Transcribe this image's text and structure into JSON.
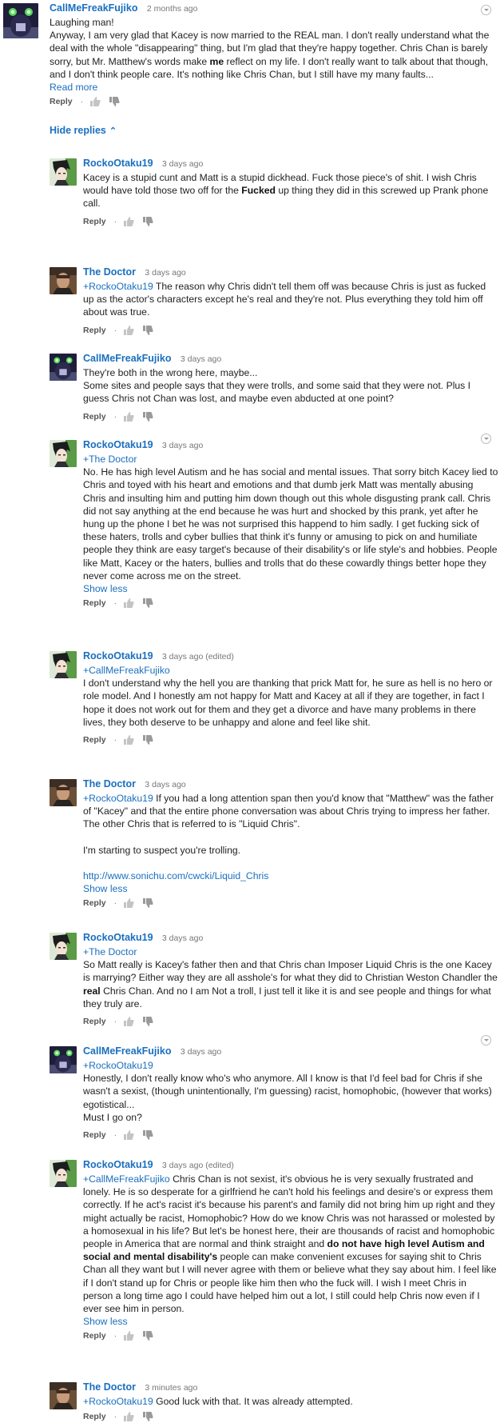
{
  "labels": {
    "reply": "Reply",
    "dot": "·",
    "read_more": "Read more",
    "show_less": "Show less",
    "hide_replies": "Hide replies"
  },
  "comments": [
    {
      "author": "CallMeFreakFujiko",
      "time": "2 months ago",
      "lines": [
        "Laughing man!",
        "Anyway, I am very glad that Kacey is now married to the REAL man. I don't really understand what the deal with the whole \"disappearing\" thing, but I'm glad that they're happy together. Chris Chan is barely sorry, but Mr. Matthew's words make ",
        "me",
        " reflect on my life. I don't really want to talk about that though, and I don't think people care. It's nothing like Chris Chan, but I still have my many faults..."
      ]
    },
    {
      "author": "RockoOtaku19",
      "time": "3 days ago",
      "t1": "Kacey is a stupid cunt and Matt is a stupid dickhead. Fuck those piece's of shit. I wish Chris would have told those two off for the ",
      "b1": "Fucked",
      "t2": " up thing they did in this screwed up Prank phone call."
    },
    {
      "author": "The Doctor",
      "time": "3 days ago",
      "mention": "+RockoOtaku19",
      "text": " The reason why Chris didn't tell them off was because Chris is just as fucked up as the actor's characters except he's real and they're not. Plus everything they told him off about was true."
    },
    {
      "author": "CallMeFreakFujiko",
      "time": "3 days ago",
      "lines": [
        "They're both in the wrong here, maybe...",
        "Some sites and people says that they were trolls, and some said that they were not. Plus I guess Chris not Chan was lost, and maybe even abducted at one point?"
      ]
    },
    {
      "author": "RockoOtaku19",
      "time": "3 days ago",
      "mention": "+The Doctor",
      "text": "No. He has high level Autism and he has social and mental issues. That sorry bitch Kacey lied to Chris and toyed with his heart and emotions and that dumb jerk Matt was mentally abusing Chris and insulting him and putting him down though out this whole disgusting prank call. Chris did not say anything at the end because he was hurt and shocked by this prank, yet after he hung up the phone I bet he was not surprised this happend to him sadly.  I get fucking sick of these haters, trolls and cyber bullies that think it's funny or amusing to pick on and humiliate people they think are easy target's because of their disability's or life style's and hobbies. People like Matt, Kacey or the haters, bullies and trolls that do these cowardly things better hope they never come across me on the street."
    },
    {
      "author": "RockoOtaku19",
      "time": "3 days ago (edited)",
      "mention": "+CallMeFreakFujiko",
      "text": "I don't understand why the hell you are thanking that prick Matt for, he sure as hell is no hero or role model.  And I honestly am not happy for Matt and Kacey at all if they are together, in fact I hope it does not work out for them and they get a divorce and have many problems in there lives, they both deserve to be unhappy and alone and feel like shit."
    },
    {
      "author": "The Doctor",
      "time": "3 days ago",
      "mention": "+RockoOtaku19",
      "text": " If you had a long attention span then you'd know that \"Matthew\" was the father of \"Kacey\" and that the entire phone conversation was about Chris trying to impress her father. The other Chris that is referred to is \"Liquid Chris\".",
      "text2": "I'm starting to suspect you're trolling.",
      "link": "http://www.sonichu.com/cwcki/Liquid_Chris"
    },
    {
      "author": "RockoOtaku19",
      "time": "3 days ago",
      "mention": "+The Doctor",
      "t1": "So Matt really is Kacey's father then and that Chris chan Imposer Liquid Chris is the one Kacey is marrying?  Either way they are all asshole's for what they did to Christian Weston Chandler the ",
      "b1": "real",
      "t2": " Chris Chan.  And no I am Not a troll, I just tell it like it is and see people and things for what they truly are."
    },
    {
      "author": "CallMeFreakFujiko",
      "time": "3 days ago",
      "mention": "+RockoOtaku19",
      "text": "Honestly, I don't really know who's who anymore. All I know is that I'd feel bad for Chris if she wasn't a sexist, (though unintentionally, I'm guessing) racist, homophobic, (however that works) egotistical...",
      "text2": "Must I go on?"
    },
    {
      "author": "RockoOtaku19",
      "time": "3 days ago (edited)",
      "mention": "+CallMeFreakFujiko",
      "t1": " Chris Chan is not sexist,  it's obvious he is very sexually frustrated and lonely.  He is so desperate for a girlfriend he can't hold his feelings and desire's or express them correctly.   If he act's racist it's because his parent's and family did not bring him up right and they might actually be racist, Homophobic?  How do we know Chris was not harassed or molested by a homosexual in his life?  But let's be honest here, their are thousands of racist and homophobic people in America that are normal and think straight and ",
      "b1": "do not have high level Autism and social and mental disability's",
      "t2": " people can make convenient  excuses for saying shit to Chris Chan all they want but I will never agree with them or believe what they say about him. I feel like if I don't stand up for Chris or people like him then who the fuck will. I wish I meet Chris in person a long time ago I could have helped him out a lot, I still could help Chris now even if I ever see him in person."
    },
    {
      "author": "The Doctor",
      "time": "3 minutes ago",
      "mention": "+RockoOtaku19",
      "text": " Good luck with that. It was already attempted."
    }
  ],
  "colors": {
    "author": "#1a6fbf",
    "link": "#1a6fbf",
    "meta": "#777777"
  },
  "icons": {
    "like": "thumb-up-icon",
    "dislike": "thumb-down-icon",
    "menu": "chevron-down-icon"
  }
}
